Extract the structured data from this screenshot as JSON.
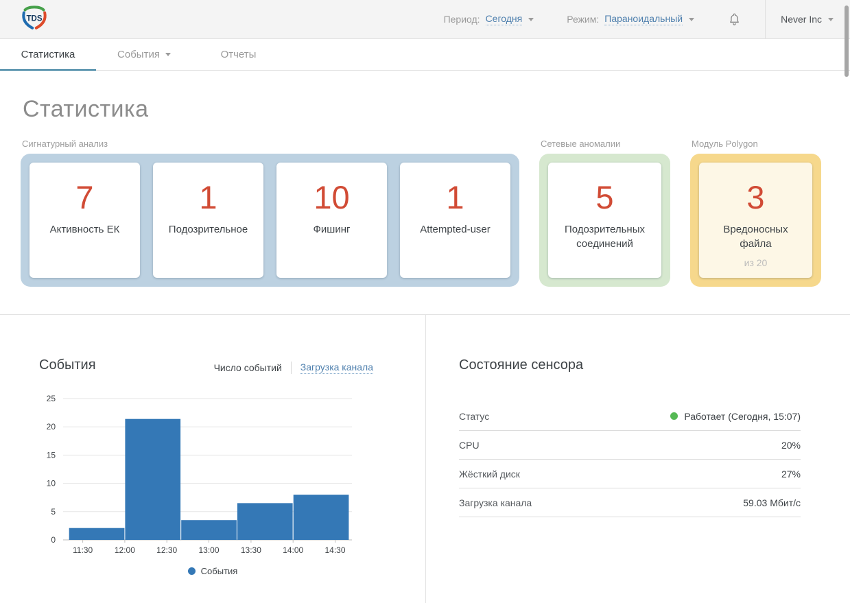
{
  "header": {
    "logo": "TDS",
    "period": {
      "label": "Период:",
      "value": "Сегодня"
    },
    "mode": {
      "label": "Режим:",
      "value": "Параноидальный"
    },
    "account": "Never Inc"
  },
  "tabs": {
    "statistics": "Статистика",
    "events": "События",
    "reports": "Отчеты"
  },
  "page_title": "Статистика",
  "stats": {
    "signature": {
      "label": "Сигнатурный анализ",
      "accent": "#bcd1e1",
      "cards": [
        {
          "value": "7",
          "label": "Активность ЕК"
        },
        {
          "value": "1",
          "label": "Подозрительное"
        },
        {
          "value": "10",
          "label": "Фишинг"
        },
        {
          "value": "1",
          "label": "Attempted-user"
        }
      ]
    },
    "network": {
      "label": "Сетевые аномалии",
      "accent": "#d6e8cf",
      "card": {
        "value": "5",
        "label": "Подозрительных соединений"
      }
    },
    "polygon": {
      "label": "Модуль Polygon",
      "accent": "#f6d88c",
      "card": {
        "value": "3",
        "label": "Вредоносных файла",
        "sub": "из 20"
      }
    }
  },
  "events_panel": {
    "title": "События",
    "toggle_current": "Число событий",
    "toggle_link": "Загрузка канала",
    "legend": "События"
  },
  "chart_data": {
    "type": "bar",
    "title": "События — число событий",
    "xlabel": "",
    "ylabel": "",
    "x_tick_labels": [
      "11:30",
      "12:00",
      "12:30",
      "13:00",
      "13:30",
      "14:00",
      "14:30"
    ],
    "x_tick_minutes": [
      690,
      720,
      750,
      780,
      810,
      840,
      870
    ],
    "bin_edges": [
      "11:20",
      "12:00",
      "12:40",
      "13:20",
      "14:00",
      "14:40"
    ],
    "bin_edge_minutes": [
      680,
      720,
      760,
      800,
      840,
      880
    ],
    "series": [
      {
        "name": "События",
        "color": "#3478b6",
        "values": [
          2.1,
          21.4,
          3.5,
          6.5,
          8
        ]
      }
    ],
    "x_domain_minutes": [
      676,
      882
    ],
    "ylim": [
      0,
      25
    ],
    "yticks": [
      0,
      5,
      10,
      15,
      20,
      25
    ],
    "grid": true,
    "legend_position": "bottom"
  },
  "sensor_panel": {
    "title": "Состояние сенсора",
    "rows": [
      {
        "label": "Статус",
        "value": "Работает (Сегодня, 15:07)",
        "status_dot_color": "#55b954"
      },
      {
        "label": "CPU",
        "value": "20%"
      },
      {
        "label": "Жёсткий диск",
        "value": "27%"
      },
      {
        "label": "Загрузка канала",
        "value": "59.03 Мбит/с"
      }
    ]
  },
  "colors": {
    "accent_link": "#4f80ae",
    "tab_underline": "#3a7f9e",
    "stat_number": "#d14b35",
    "bar": "#3478b6",
    "status_ok": "#55b954",
    "topbar_bg": "#f4f4f4"
  }
}
